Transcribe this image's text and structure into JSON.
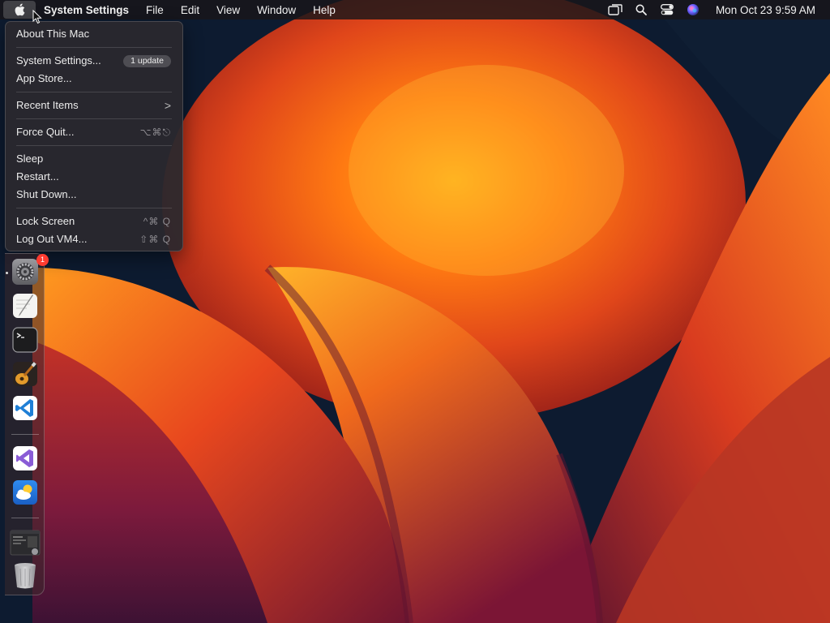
{
  "menubar": {
    "app_name": "System Settings",
    "menus": [
      "File",
      "Edit",
      "View",
      "Window",
      "Help"
    ],
    "clock": "Mon Oct 23  9:59 AM",
    "status_icons": [
      "screen-mirroring-icon",
      "spotlight-search-icon",
      "control-center-icon",
      "siri-icon"
    ]
  },
  "apple_menu": {
    "about": "About This Mac",
    "system_settings": "System Settings...",
    "update_badge": "1 update",
    "app_store": "App Store...",
    "recent_items": "Recent Items",
    "recent_chevron": ">",
    "force_quit": "Force Quit...",
    "force_quit_shortcut": "⌥⌘⎋",
    "sleep": "Sleep",
    "restart": "Restart...",
    "shut_down": "Shut Down...",
    "lock_screen": "Lock Screen",
    "lock_screen_shortcut": "^⌘ Q",
    "log_out": "Log Out VM4...",
    "log_out_shortcut": "⇧⌘ Q"
  },
  "dock": {
    "settings_badge": "1",
    "items": [
      "system-settings",
      "textedit",
      "terminal",
      "garageband",
      "vscode",
      "visual-studio",
      "weather",
      "recent-window",
      "trash"
    ]
  },
  "colors": {
    "menubar_bg": "#18161a",
    "menu_bg": "#2a282e",
    "badge_red": "#ff3b30",
    "vscode_blue": "#1f7fd6",
    "vs_purple": "#8a5cd6"
  }
}
